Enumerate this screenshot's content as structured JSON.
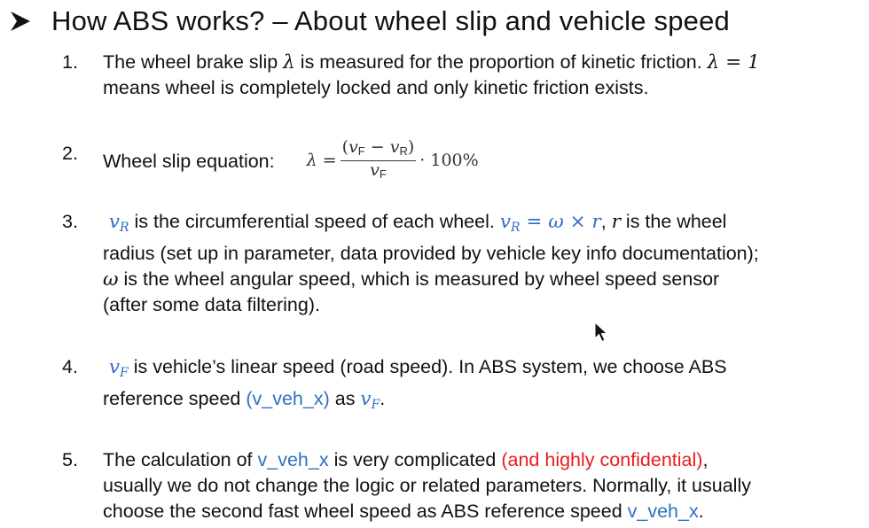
{
  "title": {
    "bullet_icon": "arrowhead-bullet-icon",
    "text": "How ABS works? – About wheel slip and vehicle speed"
  },
  "items": [
    {
      "number": "1.",
      "s1": "The wheel brake slip ",
      "lambda": "λ",
      "s2": " is measured for the proportion of kinetic friction. ",
      "eq": "λ = 1",
      "s3": "means wheel is completely locked and only kinetic friction exists."
    },
    {
      "number": "2.",
      "label": "Wheel slip equation:",
      "eq_lhs": "λ =",
      "numerator_open": "(",
      "vf": "v",
      "vf_sub": "F",
      "minus": " − ",
      "vr": "v",
      "vr_sub": "R",
      "numerator_close": ")",
      "denominator": "v",
      "denominator_sub": "F",
      "tail": "· 100%"
    },
    {
      "number": "3.",
      "v": "v",
      "v_sub": "R",
      "s1": " is the circumferential speed of each wheel. ",
      "eq_v": "v",
      "eq_v_sub": "R",
      "eq_rest": " = ω × r",
      "s2": ", ",
      "r": "r",
      "s3": " is the wheel",
      "line2": "radius (set up in parameter, data provided by vehicle key info documentation);",
      "omega": "ω",
      "s4": " is the wheel angular speed, which is measured by wheel speed sensor",
      "line4": "(after some data filtering)."
    },
    {
      "number": "4.",
      "v": "v",
      "v_sub": "F",
      "s1": " is vehicle’s linear speed (road speed). In ABS system, we choose ABS",
      "s2": "reference speed ",
      "highlight": "(v_veh_x)",
      "s3": " as ",
      "v2": "v",
      "v2_sub": "F",
      "s4": "."
    },
    {
      "number": "5.",
      "s1": "The calculation of ",
      "hl1": "v_veh_x",
      "s2": " is very complicated ",
      "red": "(and highly confidential)",
      "s3": ",",
      "line2": "usually we do not change the logic or related parameters. Normally, it usually",
      "s4": "choose the second fast wheel speed as ABS reference speed ",
      "hl2": "v_veh_x",
      "s5": "."
    }
  ],
  "cursor_icon": "mouse-pointer-icon",
  "colors": {
    "text": "#111111",
    "highlight_blue": "#2f6fc0",
    "highlight_red": "#e81c1c",
    "background": "#ffffff"
  }
}
